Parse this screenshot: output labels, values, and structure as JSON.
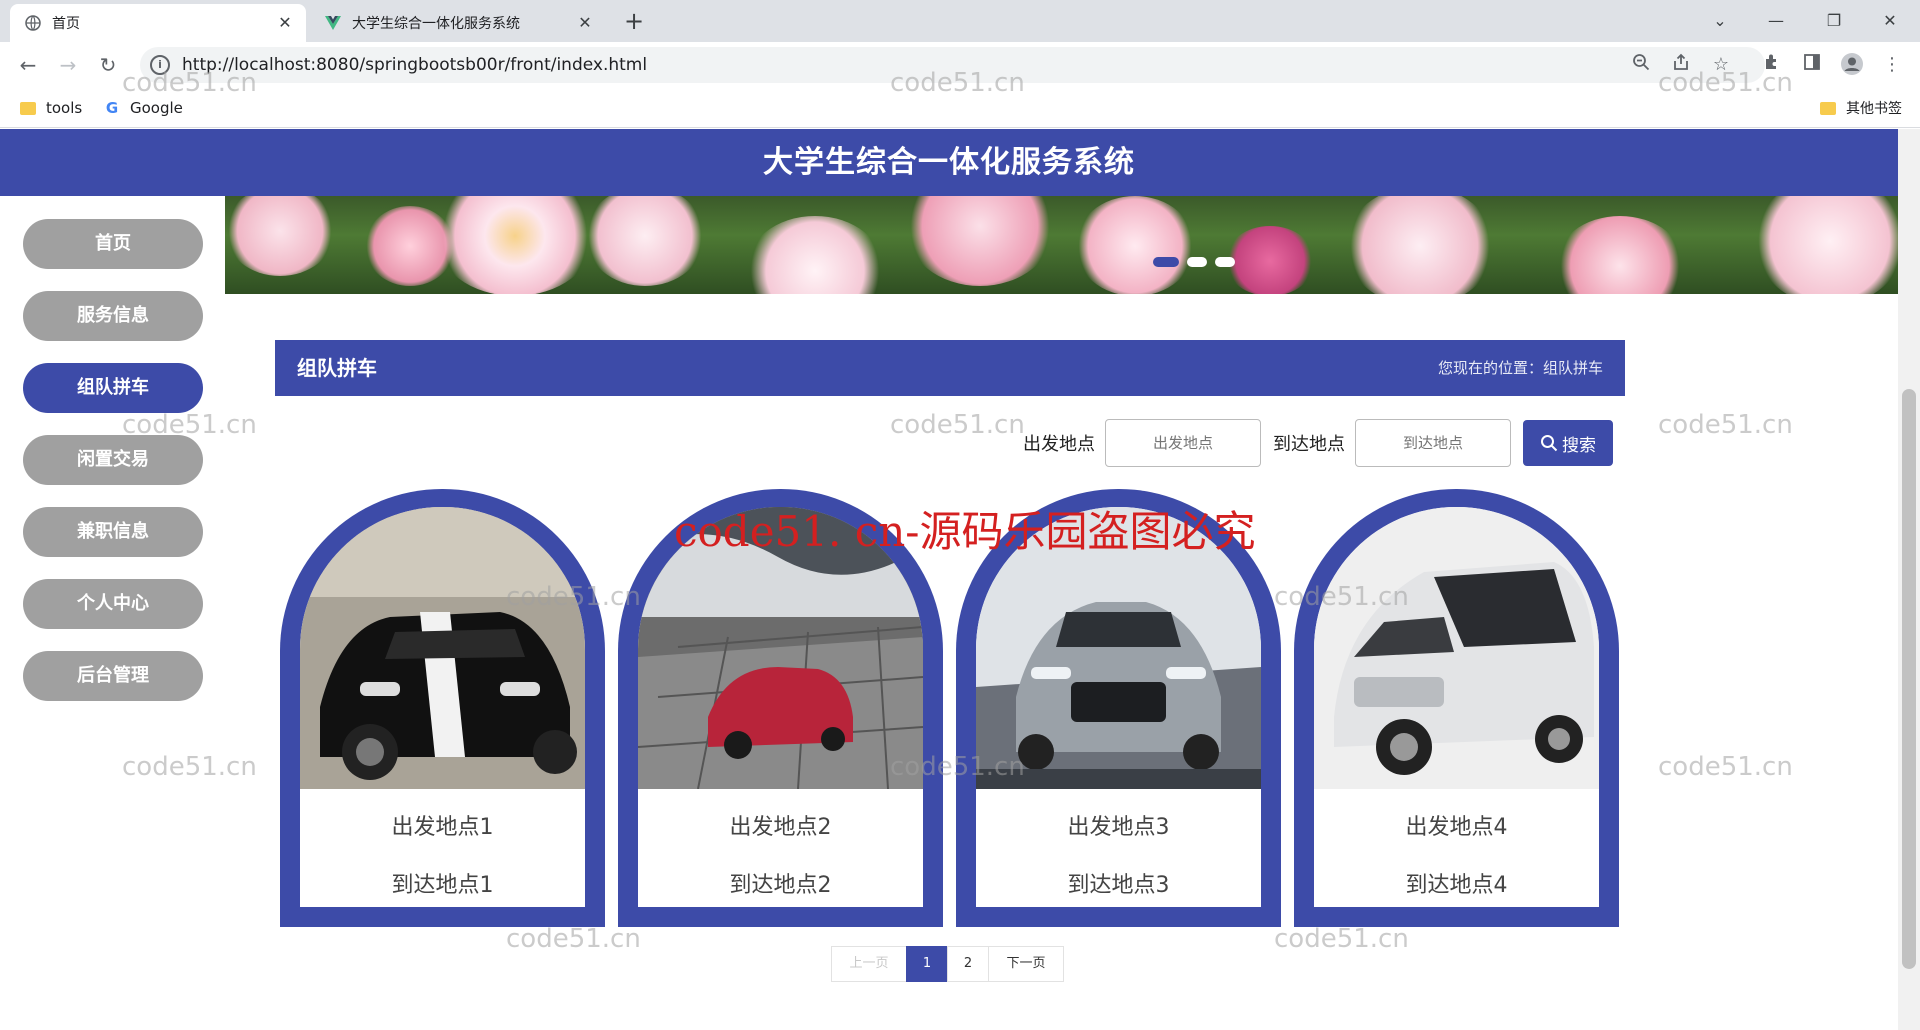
{
  "browser": {
    "tabs": [
      {
        "title": "首页",
        "active": true
      },
      {
        "title": "大学生综合一体化服务系统",
        "active": false
      }
    ],
    "url": "http://localhost:8080/springbootsb00r/front/index.html",
    "url_host": "http://localhost",
    "url_rest": ":8080/springbootsb00r/front/index.html",
    "bookmarks": [
      {
        "label": "tools",
        "icon": "folder-icon"
      },
      {
        "label": "Google",
        "icon": "google-icon"
      }
    ],
    "other_bookmarks": "其他书签"
  },
  "site": {
    "title": "大学生综合一体化服务系统"
  },
  "sidebar": {
    "items": [
      {
        "label": "首页",
        "active": false
      },
      {
        "label": "服务信息",
        "active": false
      },
      {
        "label": "组队拼车",
        "active": true
      },
      {
        "label": "闲置交易",
        "active": false
      },
      {
        "label": "兼职信息",
        "active": false
      },
      {
        "label": "个人中心",
        "active": false
      },
      {
        "label": "后台管理",
        "active": false
      }
    ]
  },
  "section": {
    "title": "组队拼车",
    "breadcrumb": "您现在的位置：组队拼车"
  },
  "search": {
    "from_label": "出发地点",
    "from_placeholder": "出发地点",
    "to_label": "到达地点",
    "to_placeholder": "到达地点",
    "button_label": "搜索"
  },
  "cards": [
    {
      "from": "出发地点1",
      "to": "到达地点1",
      "image": "black-muscle-car"
    },
    {
      "from": "出发地点2",
      "to": "到达地点2",
      "image": "red-convertible"
    },
    {
      "from": "出发地点3",
      "to": "到达地点3",
      "image": "silver-hatchback"
    },
    {
      "from": "出发地点4",
      "to": "到达地点4",
      "image": "white-minivan"
    }
  ],
  "pagination": {
    "prev": "上一页",
    "pages": [
      "1",
      "2"
    ],
    "current": "1",
    "next": "下一页"
  },
  "watermarks": {
    "site": "code51.cn",
    "notice": "code51. cn-源码乐园盗图必究"
  },
  "colors": {
    "accent": "#3d4ba8",
    "sidebar_inactive": "#a0a0a0",
    "watermark_red": "#d42020"
  }
}
